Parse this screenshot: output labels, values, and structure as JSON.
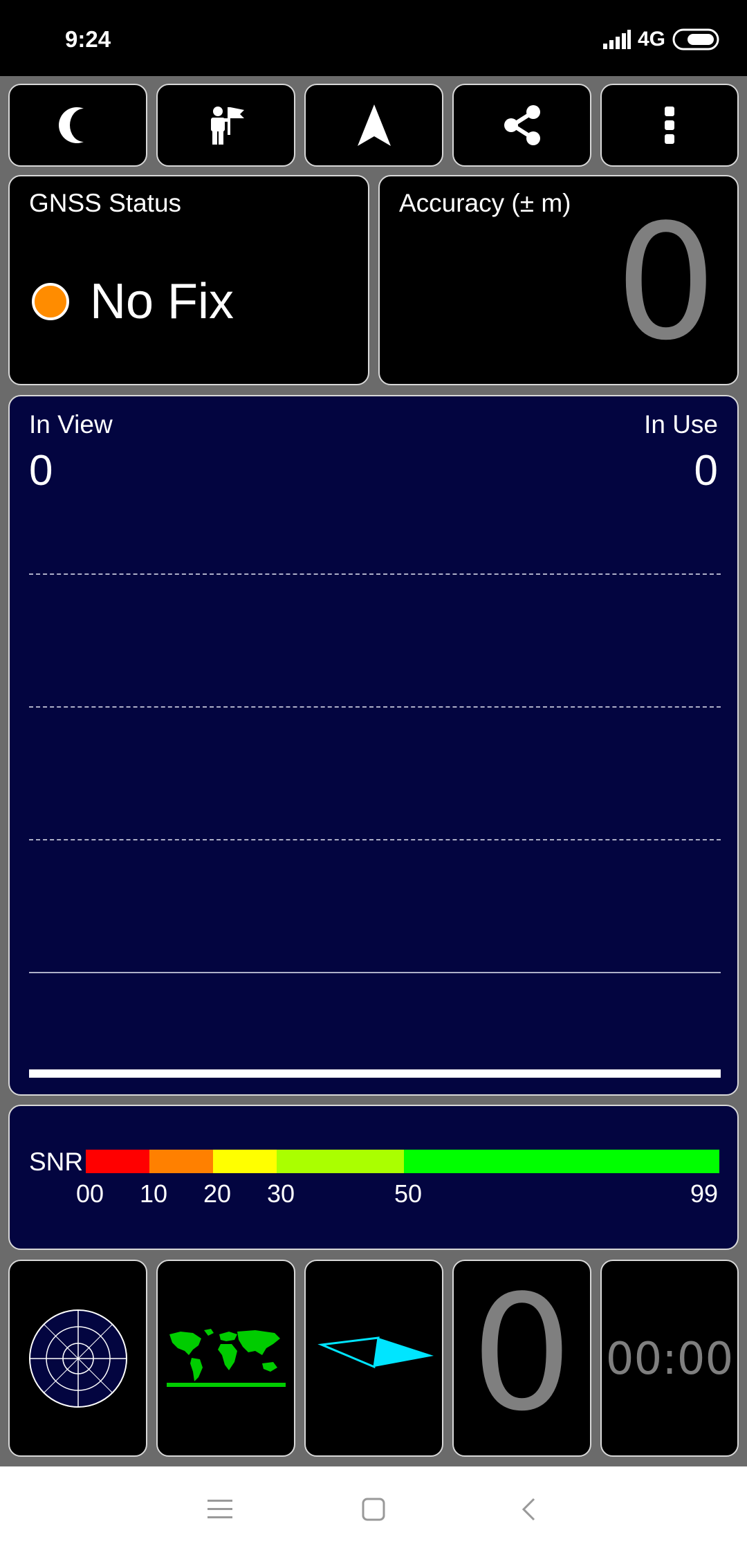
{
  "status_bar": {
    "time": "9:24",
    "network": "4G",
    "signal_icon": "signal-bars-icon",
    "battery_icon": "battery-icon"
  },
  "toolbar": {
    "buttons": [
      {
        "icon": "moon-icon"
      },
      {
        "icon": "person-flag-icon"
      },
      {
        "icon": "navigation-arrow-icon"
      },
      {
        "icon": "share-icon"
      },
      {
        "icon": "more-vert-icon"
      }
    ]
  },
  "gnss": {
    "label": "GNSS Status",
    "status": "No Fix",
    "status_color": "#ff8c00"
  },
  "accuracy": {
    "label": "Accuracy (± m)",
    "value": "0"
  },
  "satellites": {
    "in_view_label": "In View",
    "in_view_value": "0",
    "in_use_label": "In Use",
    "in_use_value": "0",
    "background": "#030540"
  },
  "snr": {
    "label": "SNR",
    "segments": [
      {
        "from": 0,
        "to": 10,
        "color": "#ff0000"
      },
      {
        "from": 10,
        "to": 20,
        "color": "#ff8000"
      },
      {
        "from": 20,
        "to": 30,
        "color": "#ffff00"
      },
      {
        "from": 30,
        "to": 50,
        "color": "#aaff00"
      },
      {
        "from": 50,
        "to": 99,
        "color": "#00ff00"
      }
    ],
    "ticks": [
      "00",
      "10",
      "20",
      "30",
      "50",
      "99"
    ]
  },
  "bottom_tiles": {
    "radar_icon": "sky-radar-icon",
    "map_icon": "world-map-icon",
    "compass_icon": "compass-needle-icon",
    "speed_value": "0",
    "timer_value": "00:00"
  },
  "nav_bar": {
    "menu_icon": "menu-icon",
    "home_icon": "home-square-icon",
    "back_icon": "back-chevron-icon"
  }
}
